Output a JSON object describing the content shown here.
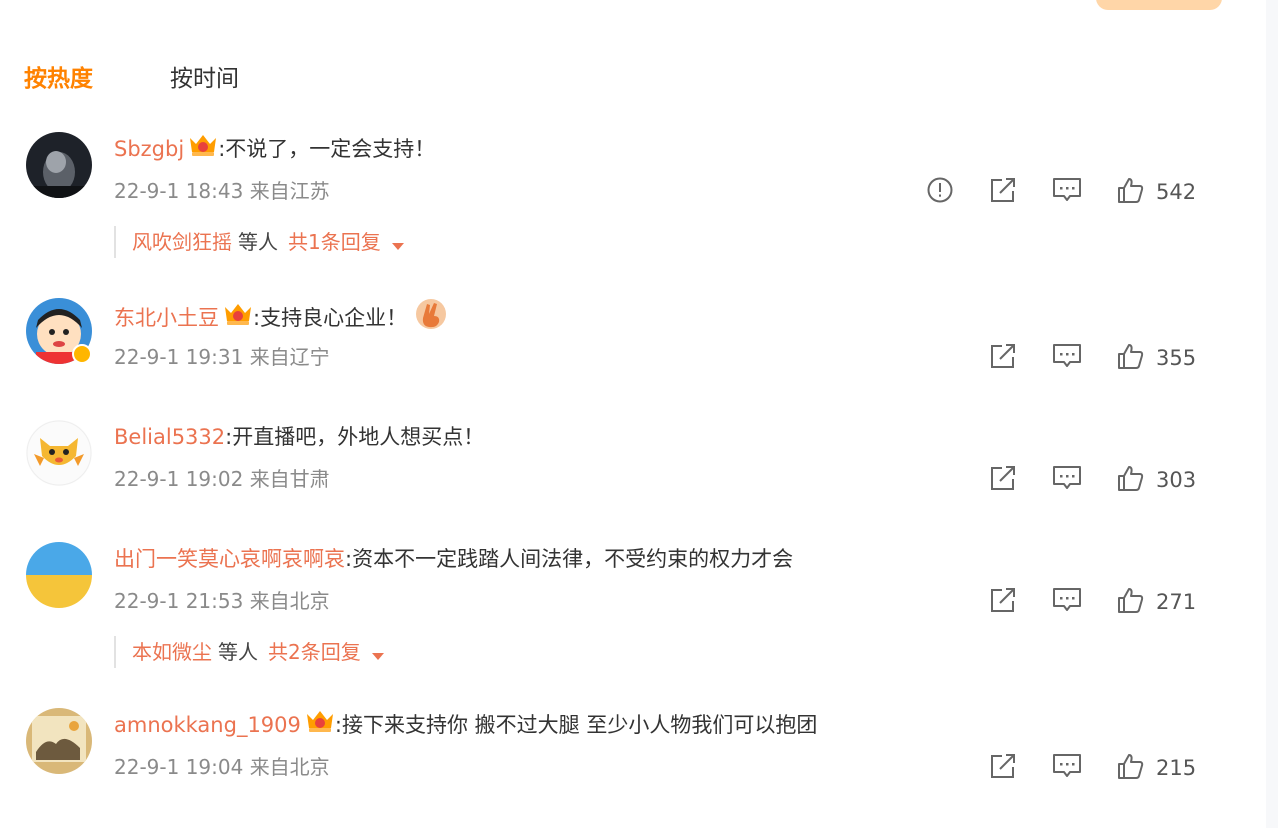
{
  "tabs": {
    "hot": "按热度",
    "time": "按时间"
  },
  "colors": {
    "accent": "#ff8200",
    "username": "#eb7350",
    "meta": "#8a8a8a"
  },
  "comments": [
    {
      "user": "Sbzgbj",
      "text": ":不说了，一定会支持！",
      "time": "22-9-1 18:43",
      "location": "来自江苏",
      "likes": "542",
      "badge": "crown-icon",
      "report": true,
      "replies": {
        "name": "风吹剑狂摇",
        "mid": "等人",
        "total": "共1条回复"
      }
    },
    {
      "user": "东北小土豆",
      "text": ":支持良心企业！",
      "time": "22-9-1 19:31",
      "location": "来自辽宁",
      "likes": "355",
      "badge": "crown-icon",
      "emoji": "victory-hand-emoji"
    },
    {
      "user": "Belial5332",
      "text": ":开直播吧，外地人想买点！",
      "time": "22-9-1 19:02",
      "location": "来自甘肃",
      "likes": "303"
    },
    {
      "user": "出门一笑莫心哀啊哀啊哀",
      "text": ":资本不一定践踏人间法律，不受约束的权力才会",
      "time": "22-9-1 21:53",
      "location": "来自北京",
      "likes": "271",
      "replies": {
        "name": "本如微尘",
        "mid": "等人",
        "total": "共2条回复"
      }
    },
    {
      "user": "amnokkang_1909",
      "text": ":接下来支持你 搬不过大腿 至少小人物我们可以抱团",
      "time": "22-9-1 19:04",
      "location": "来自北京",
      "likes": "215",
      "badge": "crown-icon"
    }
  ]
}
